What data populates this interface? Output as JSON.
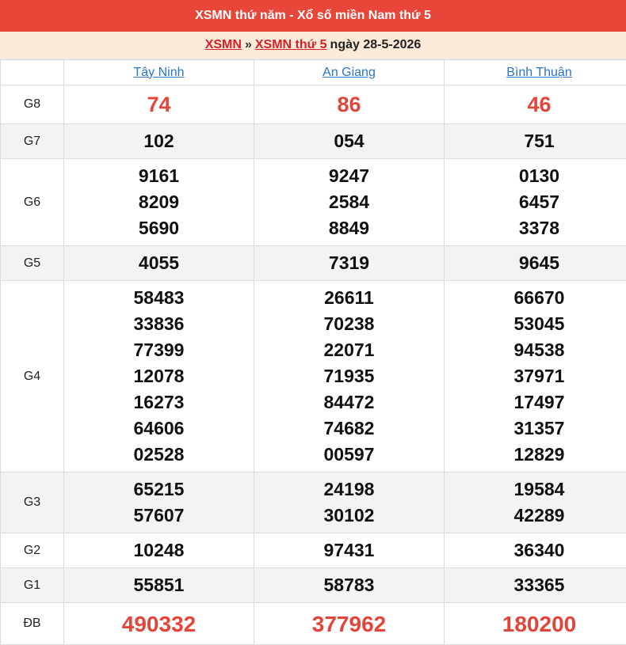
{
  "header": {
    "title": "XSMN thứ năm - Xổ số miền Nam thứ 5"
  },
  "breadcrumb": {
    "link1": "XSMN",
    "separator": "»",
    "link2": "XSMN thứ 5",
    "date_text": "ngày 28-5-2026"
  },
  "provinces": [
    "Tây Ninh",
    "An Giang",
    "Bình Thuận"
  ],
  "accent_color": "#e9463a",
  "prizes": [
    {
      "key": "g8",
      "label": "G8",
      "values": [
        [
          "74"
        ],
        [
          "86"
        ],
        [
          "46"
        ]
      ]
    },
    {
      "key": "g7",
      "label": "G7",
      "values": [
        [
          "102"
        ],
        [
          "054"
        ],
        [
          "751"
        ]
      ]
    },
    {
      "key": "g6",
      "label": "G6",
      "values": [
        [
          "9161",
          "8209",
          "5690"
        ],
        [
          "9247",
          "2584",
          "8849"
        ],
        [
          "0130",
          "6457",
          "3378"
        ]
      ]
    },
    {
      "key": "g5",
      "label": "G5",
      "values": [
        [
          "4055"
        ],
        [
          "7319"
        ],
        [
          "9645"
        ]
      ]
    },
    {
      "key": "g4",
      "label": "G4",
      "values": [
        [
          "58483",
          "33836",
          "77399",
          "12078",
          "16273",
          "64606",
          "02528"
        ],
        [
          "26611",
          "70238",
          "22071",
          "71935",
          "84472",
          "74682",
          "00597"
        ],
        [
          "66670",
          "53045",
          "94538",
          "37971",
          "17497",
          "31357",
          "12829"
        ]
      ]
    },
    {
      "key": "g3",
      "label": "G3",
      "values": [
        [
          "65215",
          "57607"
        ],
        [
          "24198",
          "30102"
        ],
        [
          "19584",
          "42289"
        ]
      ]
    },
    {
      "key": "g2",
      "label": "G2",
      "values": [
        [
          "10248"
        ],
        [
          "97431"
        ],
        [
          "36340"
        ]
      ]
    },
    {
      "key": "g1",
      "label": "G1",
      "values": [
        [
          "55851"
        ],
        [
          "58783"
        ],
        [
          "33365"
        ]
      ]
    },
    {
      "key": "db",
      "label": "ĐB",
      "values": [
        [
          "490332"
        ],
        [
          "377962"
        ],
        [
          "180200"
        ]
      ]
    }
  ]
}
